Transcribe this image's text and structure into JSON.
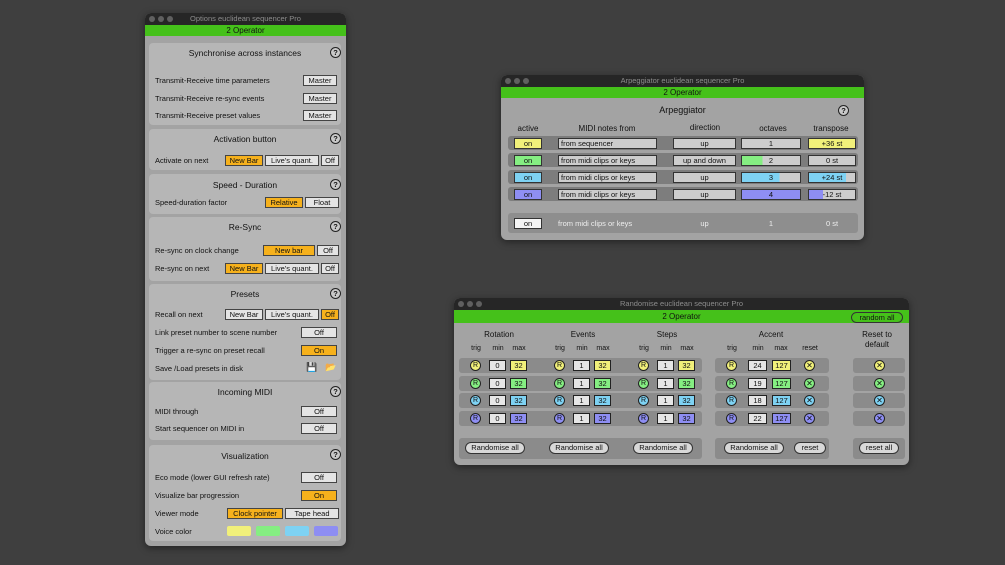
{
  "colors": {
    "accent_green": "#45c11a",
    "orange": "#f6b11c",
    "voice1": "#f1f07a",
    "voice2": "#85ee82",
    "voice3": "#7ed2f3",
    "voice4": "#8e8ef3"
  },
  "options": {
    "title": "Options euclidean sequencer Pro",
    "instance": "2 Operator",
    "sync": {
      "title": "Synchronise across instances",
      "help": "?",
      "rows": [
        {
          "label": "Transmit-Receive time parameters",
          "value": "Master"
        },
        {
          "label": "Transmit-Receive re-sync events",
          "value": "Master"
        },
        {
          "label": "Transmit-Receive preset values",
          "value": "Master"
        }
      ]
    },
    "activation": {
      "title": "Activation button",
      "help": "?",
      "label": "Activate on next",
      "opts": [
        "New Bar",
        "Live's quant.",
        "Off"
      ]
    },
    "speed": {
      "title": "Speed - Duration",
      "help": "?",
      "label": "Speed-duration factor",
      "opts": [
        "Relative",
        "Float"
      ]
    },
    "resync": {
      "title": "Re-Sync",
      "help": "?",
      "clock_label": "Re-sync on clock change",
      "clock_opts": [
        "New bar",
        "Off"
      ],
      "next_label": "Re-sync on next",
      "next_opts": [
        "New Bar",
        "Live's quant.",
        "Off"
      ]
    },
    "presets": {
      "title": "Presets",
      "help": "?",
      "recall_label": "Recall on next",
      "recall_opts": [
        "New Bar",
        "Live's quant.",
        "Off"
      ],
      "link_label": "Link preset number to scene number",
      "link_value": "Off",
      "trigger_label": "Trigger a re-sync on preset recall",
      "trigger_value": "On",
      "save_label": "Save /Load presets in disk"
    },
    "midi": {
      "title": "Incoming MIDI",
      "help": "?",
      "through_label": "MIDI through",
      "through_value": "Off",
      "start_label": "Start sequencer on MIDI in",
      "start_value": "Off"
    },
    "vis": {
      "title": "Visualization",
      "help": "?",
      "eco_label": "Eco mode (lower GUI refresh rate)",
      "eco_value": "Off",
      "bar_label": "Visualize bar progression",
      "bar_value": "On",
      "viewer_label": "Viewer mode",
      "viewer_opts": [
        "Clock pointer",
        "Tape head"
      ],
      "voice_label": "Voice color"
    }
  },
  "arp": {
    "title": "Arpeggiator euclidean sequencer Pro",
    "instance": "2 Operator",
    "heading": "Arpeggiator",
    "help": "?",
    "headers": {
      "active": "active",
      "notes": "MIDI notes from",
      "direction": "direction",
      "octaves": "octaves",
      "transpose": "transpose"
    },
    "rows": [
      {
        "active": "on",
        "notes": "from sequencer",
        "direction": "up",
        "octaves": "1",
        "transpose": "+36 st"
      },
      {
        "active": "on",
        "notes": "from midi clips or keys",
        "direction": "up and down",
        "octaves": "2",
        "transpose": "0 st"
      },
      {
        "active": "on",
        "notes": "from midi clips or keys",
        "direction": "up",
        "octaves": "3",
        "transpose": "+24 st"
      },
      {
        "active": "on",
        "notes": "from midi clips or keys",
        "direction": "up",
        "octaves": "4",
        "transpose": "-12 st"
      }
    ],
    "global": {
      "active": "on",
      "notes": "from midi clips or keys",
      "direction": "up",
      "octaves": "1",
      "transpose": "0 st"
    }
  },
  "rand": {
    "title": "Randomise euclidean sequencer Pro",
    "instance": "2 Operator",
    "random_all": "random all",
    "groups": [
      "Rotation",
      "Events",
      "Steps",
      "Accent"
    ],
    "reset_default": [
      "Reset to",
      "default"
    ],
    "sub": {
      "trig": "trig",
      "min": "min",
      "max": "max",
      "reset": "reset"
    },
    "trig_letter": "R",
    "rows": [
      {
        "rot": [
          "0",
          "32"
        ],
        "ev": [
          "1",
          "32"
        ],
        "st": [
          "1",
          "32"
        ],
        "acc": [
          "24",
          "127"
        ]
      },
      {
        "rot": [
          "0",
          "32"
        ],
        "ev": [
          "1",
          "32"
        ],
        "st": [
          "1",
          "32"
        ],
        "acc": [
          "19",
          "127"
        ]
      },
      {
        "rot": [
          "0",
          "32"
        ],
        "ev": [
          "1",
          "32"
        ],
        "st": [
          "1",
          "32"
        ],
        "acc": [
          "18",
          "127"
        ]
      },
      {
        "rot": [
          "0",
          "32"
        ],
        "ev": [
          "1",
          "32"
        ],
        "st": [
          "1",
          "32"
        ],
        "acc": [
          "22",
          "127"
        ]
      }
    ],
    "randomise_all": "Randomise all",
    "reset": "reset",
    "reset_all": "reset all"
  }
}
